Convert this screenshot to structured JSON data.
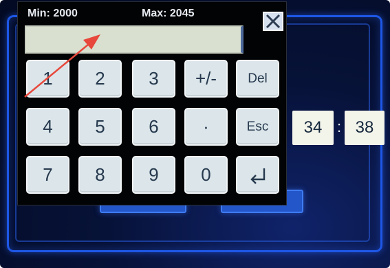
{
  "background": {
    "left_button": "",
    "right_button": "",
    "time": {
      "hours": "34",
      "separator": ":",
      "minutes": "38"
    }
  },
  "keypad": {
    "min_label": "Min: 2000",
    "max_label": "Max: 2045",
    "entry_value": "",
    "keys": {
      "k1": "1",
      "k2": "2",
      "k3": "3",
      "sign": "+/-",
      "del": "Del",
      "k4": "4",
      "k5": "5",
      "k6": "6",
      "dot": "·",
      "esc": "Esc",
      "k7": "7",
      "k8": "8",
      "k9": "9",
      "k0": "0"
    },
    "close_icon": "close-x-icon",
    "enter_icon": "enter-return-icon"
  },
  "colors": {
    "screen_bg": "#071238",
    "frame_blue": "#1e57e6",
    "key_face": "#dbe5ea",
    "entry_bg": "#d9e0cf",
    "annotation_arrow": "#e8473b"
  }
}
